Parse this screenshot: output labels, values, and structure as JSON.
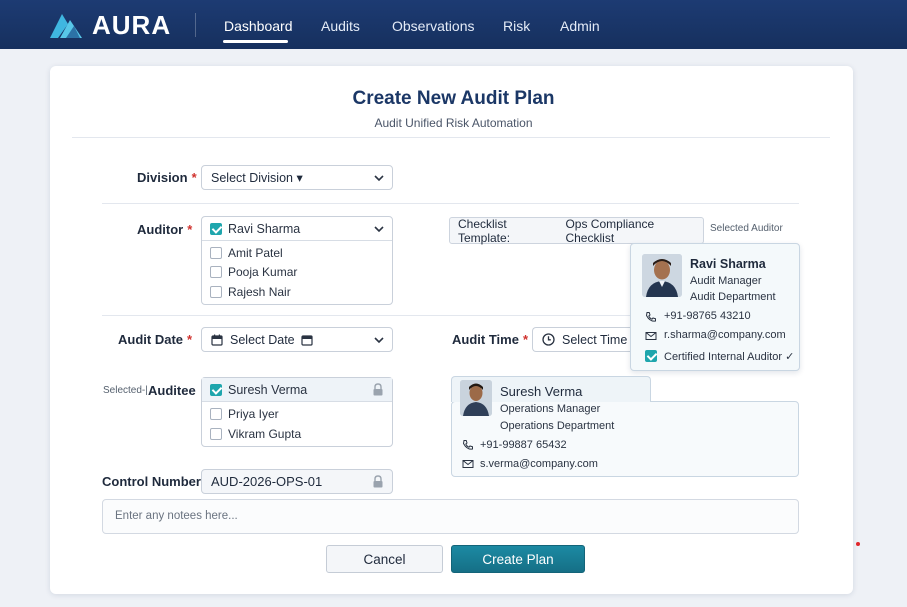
{
  "app": {
    "brand": "AURA"
  },
  "nav": {
    "items": [
      "Dashboard",
      "Audits",
      "Observations",
      "Risk",
      "Admin"
    ],
    "active": "Dashboard"
  },
  "form": {
    "title": "Create New Audit Plan",
    "subtitle": "Audit Unified Risk Automation",
    "division": {
      "label": "Division",
      "value": "Select Division ▾"
    },
    "auditor": {
      "label": "Auditor",
      "selected": "Ravi Sharma",
      "options": [
        "Amit Patel",
        "Pooja Kumar",
        "Rajesh Nair"
      ]
    },
    "checklist": {
      "label": "Checklist Template:",
      "value": "Ops Compliance Checklist"
    },
    "selected_auditor_label": "Selected Auditor",
    "auditor_card": {
      "name": "Ravi Sharma",
      "role": "Audit Manager",
      "department": "Audit Department",
      "phone": "+91-98765 43210",
      "email": "r.sharma@company.com",
      "certification": "Certified Internal Auditor ✓"
    },
    "audit_date": {
      "label": "Audit Date",
      "value": "Select Date"
    },
    "audit_time": {
      "label": "Audit Time",
      "value": "Select Time ("
    },
    "auditee": {
      "label": "Auditee",
      "prefix": "Selected-|",
      "selected": "Suresh Verma",
      "options": [
        "Priya Iyer",
        "Vikram Gupta"
      ]
    },
    "auditee_card": {
      "name": "Suresh Verma",
      "role": "Operations Manager",
      "department": "Operations Department",
      "phone": "+91-99887 65432",
      "email": "s.verma@company.com"
    },
    "control_number": {
      "label": "Control Number",
      "value": "AUD-2026-OPS-01"
    },
    "notes": {
      "placeholder": "Enter any notees here..."
    },
    "buttons": {
      "cancel": "Cancel",
      "create": "Create Plan"
    }
  },
  "colors": {
    "nav_bg": "#1d3b73",
    "accent": "#1fa6ad",
    "primary_button": "#1c8aa3",
    "required": "#d0312d"
  },
  "icons": [
    "aura-logo-icon",
    "chevron-down-icon",
    "calendar-icon",
    "clock-icon",
    "lock-icon",
    "phone-icon",
    "mail-icon",
    "checkbox-icon"
  ]
}
